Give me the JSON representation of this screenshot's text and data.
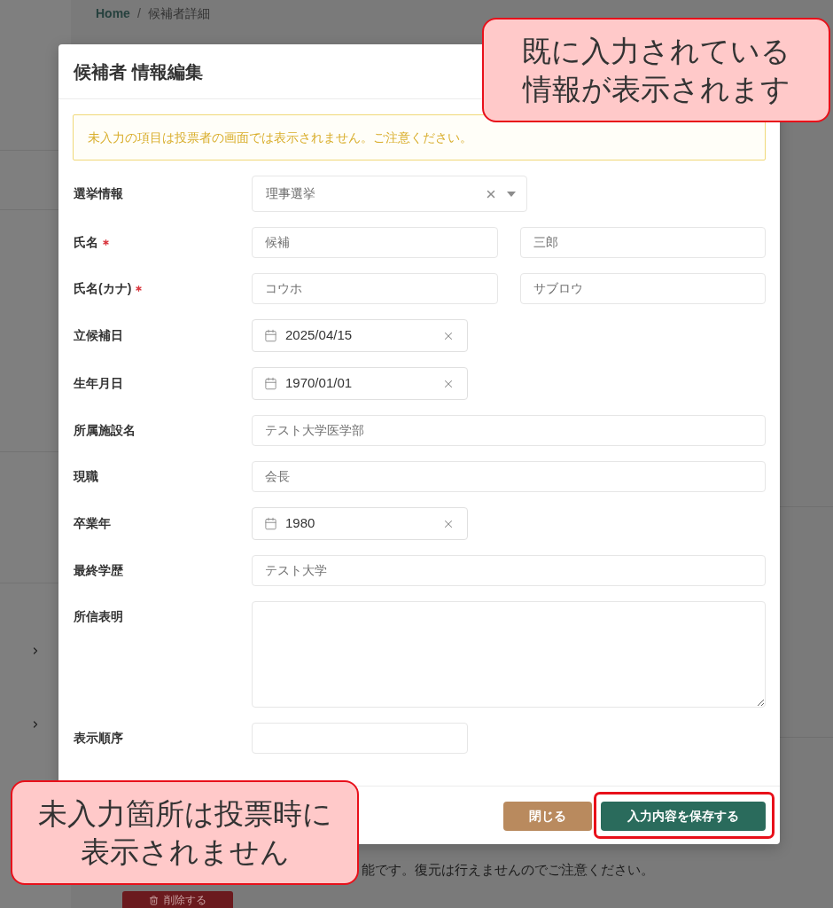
{
  "breadcrumb": {
    "items": [
      "Home",
      "候補者詳細"
    ],
    "separator": "/"
  },
  "modal": {
    "title": "候補者 情報編集",
    "notice": "未入力の項目は投票者の画面では表示されません。ご注意ください。",
    "fields": [
      {
        "kind": "select",
        "label": "選挙情報",
        "required": false,
        "value": "理事選挙"
      },
      {
        "kind": "pair",
        "label": "氏名",
        "required": true,
        "values": [
          "候補",
          "三郎"
        ]
      },
      {
        "kind": "pair",
        "label": "氏名(カナ)",
        "required": true,
        "values": [
          "コウホ",
          "サブロウ"
        ]
      },
      {
        "kind": "date",
        "label": "立候補日",
        "required": false,
        "value": "2025/04/15"
      },
      {
        "kind": "date",
        "label": "生年月日",
        "required": false,
        "value": "1970/01/01"
      },
      {
        "kind": "text",
        "label": "所属施設名",
        "required": false,
        "value": "テスト大学医学部"
      },
      {
        "kind": "text",
        "label": "現職",
        "required": false,
        "value": "会長"
      },
      {
        "kind": "date",
        "label": "卒業年",
        "required": false,
        "value": "1980"
      },
      {
        "kind": "text",
        "label": "最終学歴",
        "required": false,
        "value": "テスト大学"
      },
      {
        "kind": "textarea",
        "label": "所信表明",
        "required": false
      },
      {
        "kind": "short_text",
        "label": "表示順序",
        "required": false
      }
    ],
    "buttons": [
      {
        "label": "閉じる",
        "kind": "secondary",
        "highlighted": false
      },
      {
        "label": "入力内容を保存する",
        "kind": "primary",
        "highlighted": true
      }
    ]
  },
  "background_page": {
    "notice_fragment": "能です。復元は行えませんのでご注意ください。",
    "delete_button": "削除する"
  },
  "annotations": [
    {
      "text": "既に入力されている情報が表示されます"
    },
    {
      "text": "未入力箇所は投票時に表示されません"
    }
  ]
}
